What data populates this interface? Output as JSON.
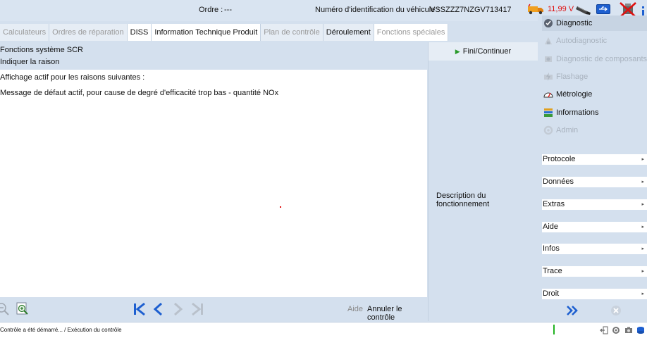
{
  "header": {
    "order_label": "Ordre :",
    "order_value": "---",
    "vin_label": "Numéro d'identification du véhicule :",
    "vin_value": "VSSZZZ7NZGV713417",
    "voltage": "11,99 V"
  },
  "tabs": [
    {
      "label": "Calculateurs",
      "state": "disabled"
    },
    {
      "label": "Ordres de réparation",
      "state": "disabled"
    },
    {
      "label": "DISS",
      "state": "enabled"
    },
    {
      "label": "Information Technique Produit",
      "state": "enabled"
    },
    {
      "label": "Plan de contrôle",
      "state": "disabled"
    },
    {
      "label": "Déroulement",
      "state": "active"
    },
    {
      "label": "Fonctions spéciales",
      "state": "disabled"
    }
  ],
  "main": {
    "title": "Fonctions système SCR",
    "subtitle": "Indiquer la raison",
    "line1": "Affichage actif pour les raisons suivantes :",
    "line2": "Message de défaut actif, pour cause de degré d'efficacité trop bas - quantité NOx"
  },
  "toolbar": {
    "help_label": "Aide",
    "cancel_label": "Annuler le contrôle"
  },
  "middle_panel": {
    "continue_label": "Fini/Continuer",
    "description_label": "Description du fonctionnement"
  },
  "right_panel": {
    "menu": [
      {
        "label": "Diagnostic",
        "enabled": true,
        "icon": "diagnostic-icon"
      },
      {
        "label": "Autodiagnostic",
        "enabled": false,
        "icon": "autodiagnostic-icon"
      },
      {
        "label": "Diagnostic de composants",
        "enabled": false,
        "icon": "component-diagnostic-icon"
      },
      {
        "label": "Flashage",
        "enabled": false,
        "icon": "flash-icon"
      },
      {
        "label": "Métrologie",
        "enabled": true,
        "icon": "gauge-icon"
      },
      {
        "label": "Informations",
        "enabled": true,
        "icon": "books-icon"
      },
      {
        "label": "Admin",
        "enabled": false,
        "icon": "admin-icon"
      }
    ],
    "sections": [
      "Protocole",
      "Données",
      "Extras",
      "Aide",
      "Infos",
      "Trace",
      "Droit"
    ]
  },
  "statusbar": {
    "text": "Contrôle a été démarré... / Exécution du contrôle"
  },
  "colors": {
    "background": "#d4e0ee",
    "voltage": "#e01010",
    "continue_arrow": "#2a9a2a",
    "nav_blue": "#1d5fd0",
    "status_green": "#21b321"
  }
}
